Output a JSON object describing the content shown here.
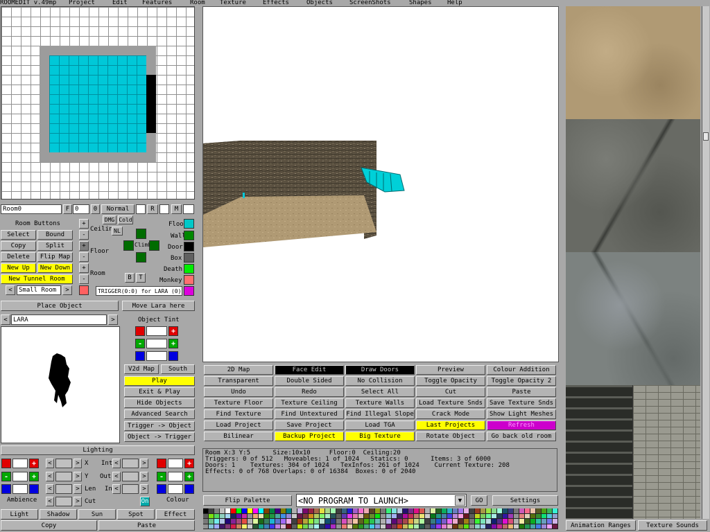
{
  "app_title": "ROOMEDIT v.49mp",
  "menu": [
    "Project",
    "Edit",
    "Features",
    "Room",
    "Texture",
    "Effects",
    "Objects",
    "ScreenShots",
    "Shapes",
    "Help"
  ],
  "room_bar": {
    "room_name": "Room0",
    "f_label": "F",
    "f_value": "0",
    "o_label": "0",
    "mode": "Normal",
    "r_label": "R",
    "m_label": "M"
  },
  "room_buttons": {
    "title": "Room Buttons",
    "select": "Select",
    "bound": "Bound",
    "copy": "Copy",
    "split": "Split",
    "delete": "Delete",
    "flip_map": "Flip Map",
    "new_up": "New Up",
    "new_down": "New Down",
    "new_tunnel": "New Tunnel Room",
    "size_value": "Small Room",
    "lt": "<",
    "gt": ">"
  },
  "height_ctrl": {
    "plus": "+",
    "minus": "-",
    "ceiling": "Ceiling",
    "floor": "Floor",
    "room": "Room",
    "dmg": "DMG",
    "cold": "Cold",
    "nl": "NL",
    "climb": "Climb",
    "b": "B",
    "t": "T"
  },
  "sector_types": [
    {
      "label": "Floor",
      "color": "#00c8c8"
    },
    {
      "label": "Wall",
      "color": "#008800"
    },
    {
      "label": "Door",
      "color": "#000000"
    },
    {
      "label": "Box",
      "color": "#606060"
    },
    {
      "label": "Death",
      "color": "#00ee00"
    },
    {
      "label": "Monkey",
      "color": "#ff7070"
    },
    {
      "label": "",
      "color": "#dd00dd"
    }
  ],
  "trigger_text": "TRIGGER(0:0) for LARA (0)",
  "place_object": "Place Object",
  "move_lara": "Move Lara here",
  "object_name": "LARA",
  "object_tint": "Object Tint",
  "object_buttons": {
    "v2d_map": "V2d Map",
    "south": "South",
    "play": "Play",
    "exit_play": "Exit & Play",
    "hide_objects": "Hide Objects",
    "advanced_search": "Advanced Search",
    "trigger_object": "Trigger -> Object",
    "object_trigger": "Object -> Trigger"
  },
  "lighting": {
    "title": "Lighting",
    "x": "X",
    "y": "Y",
    "len": "Len",
    "cut": "Cut",
    "int": "Int",
    "out": "Out",
    "in": "In",
    "ambience": "Ambience",
    "colour": "Colour",
    "on": "On"
  },
  "light_buttons": [
    "Light",
    "Shadow",
    "Sun",
    "Spot",
    "Effect"
  ],
  "copy": "Copy",
  "paste": "Paste",
  "main_buttons": [
    [
      "2D Map",
      "Face Edit",
      "Draw Doors",
      "Preview",
      "Colour Addition"
    ],
    [
      "Transparent",
      "Double Sided",
      "No Collision",
      "Toggle Opacity",
      "Toggle Opacity 2"
    ],
    [
      "Undo",
      "Redo",
      "Select All",
      "Cut",
      "Paste"
    ],
    [
      "Texture Floor",
      "Texture Ceiling",
      "Texture Walls",
      "Load Texture Snds",
      "Save Texture Snds"
    ],
    [
      "Find Texture",
      "Find Untextured",
      "Find Illegal Slope",
      "Crack Mode",
      "Show Light Meshes"
    ],
    [
      "Load Project",
      "Save Project",
      "Load TGA",
      "Last Projects",
      "Refresh"
    ],
    [
      "Bilinear",
      "Backup Project",
      "Big Texture",
      "Rotate Object",
      "Go back old room"
    ]
  ],
  "status": {
    "line1": "Room X:3 Y:5      Size:10x10     Floor:0  Ceiling:20",
    "line2": "Triggers: 0 of 512   Moveables: 1 of 1024   Statics: 0      Items: 3 of 6000",
    "line3": "Doors: 1    Textures: 304 of 1024   TexInfos: 261 of 1024    Current Texture: 208",
    "line4": "Effects: 0 of 768 Overlaps: 0 of 16384  Boxes: 0 of 2040"
  },
  "flip_palette": "Flip Palette",
  "program": "<NO PROGRAM TO LAUNCH>",
  "go": "GO",
  "settings": "Settings",
  "animation_ranges": "Animation Ranges",
  "texture_sounds": "Texture Sounds",
  "colors": {
    "yellow": "#ffff00",
    "black": "#000000",
    "magenta": "#cc00cc",
    "cyan": "#00c8c8"
  }
}
